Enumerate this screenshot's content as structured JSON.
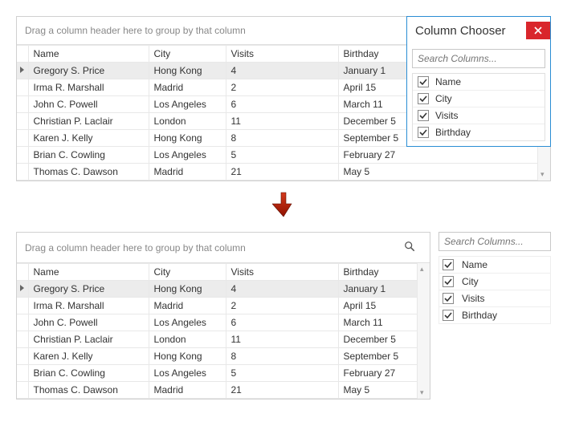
{
  "group_panel_text": "Drag a column header here to group by that column",
  "columns": {
    "name": "Name",
    "city": "City",
    "visits": "Visits",
    "birthday": "Birthday"
  },
  "rows": [
    {
      "name": "Gregory S. Price",
      "city": "Hong Kong",
      "visits": "4",
      "birthday": "January 1"
    },
    {
      "name": "Irma R. Marshall",
      "city": "Madrid",
      "visits": "2",
      "birthday": "April 15"
    },
    {
      "name": "John C. Powell",
      "city": "Los Angeles",
      "visits": "6",
      "birthday": "March 11"
    },
    {
      "name": "Christian P. Laclair",
      "city": "London",
      "visits": "11",
      "birthday": "December 5"
    },
    {
      "name": "Karen J. Kelly",
      "city": "Hong Kong",
      "visits": "8",
      "birthday": "September 5"
    },
    {
      "name": "Brian C. Cowling",
      "city": "Los Angeles",
      "visits": "5",
      "birthday": "February 27"
    },
    {
      "name": "Thomas C. Dawson",
      "city": "Madrid",
      "visits": "21",
      "birthday": "May 5"
    }
  ],
  "chooser": {
    "title": "Column Chooser",
    "search_placeholder": "Search Columns...",
    "items": [
      {
        "label": "Name",
        "checked": true
      },
      {
        "label": "City",
        "checked": true
      },
      {
        "label": "Visits",
        "checked": true
      },
      {
        "label": "Birthday",
        "checked": true
      }
    ]
  }
}
